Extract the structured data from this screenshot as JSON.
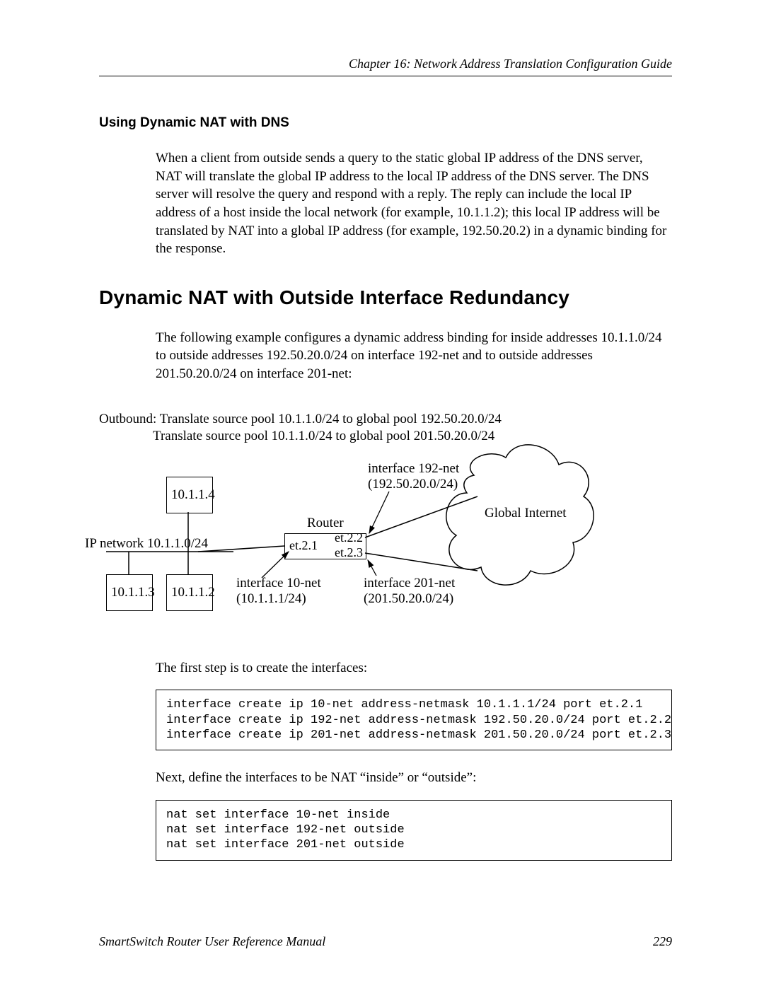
{
  "header": {
    "chapter": "Chapter 16: Network Address Translation Configuration Guide"
  },
  "subsection": {
    "title": "Using Dynamic NAT with DNS"
  },
  "paragraphs": {
    "p1": "When a client from outside sends a query to the static global IP address of the DNS server, NAT will translate the global IP address to the local IP address of the DNS server. The DNS server will resolve the query and respond with a reply. The reply can include the local IP address of a host inside the local network (for example, 10.1.1.2); this local IP address will be translated by NAT into a global IP address (for example, 192.50.20.2) in a dynamic binding for the response.",
    "p2": "The following example configures a dynamic address binding for inside addresses 10.1.1.0/24 to outside addresses 192.50.20.0/24 on interface 192-net and to outside addresses 201.50.20.0/24 on interface 201-net:",
    "p3": "The first step is to create the interfaces:",
    "p4": "Next, define the interfaces to be NAT “inside” or “outside”:"
  },
  "section": {
    "title": "Dynamic NAT with Outside Interface Redundancy"
  },
  "diagram": {
    "outbound1": "Outbound: Translate source pool 10.1.1.0/24 to global pool 192.50.20.0/24",
    "outbound2": "Translate source pool 10.1.1.0/24 to global pool 201.50.20.0/24",
    "host1": "10.1.1.4",
    "host2": "10.1.1.3",
    "host3": "10.1.1.2",
    "ipnet": "IP network 10.1.1.0/24",
    "router": "Router",
    "et21": "et.2.1",
    "et22": "et.2.2",
    "et23": "et.2.3",
    "if192a": "interface 192-net",
    "if192b": "(192.50.20.0/24)",
    "if10a": "interface 10-net",
    "if10b": "(10.1.1.1/24)",
    "if201a": "interface 201-net",
    "if201b": "(201.50.20.0/24)",
    "cloud": "Global Internet"
  },
  "code": {
    "block1": "interface create ip 10-net address-netmask 10.1.1.1/24 port et.2.1\ninterface create ip 192-net address-netmask 192.50.20.0/24 port et.2.2\ninterface create ip 201-net address-netmask 201.50.20.0/24 port et.2.3",
    "block2": "nat set interface 10-net inside\nnat set interface 192-net outside\nnat set interface 201-net outside"
  },
  "footer": {
    "manual": "SmartSwitch Router User Reference Manual",
    "page": "229"
  }
}
